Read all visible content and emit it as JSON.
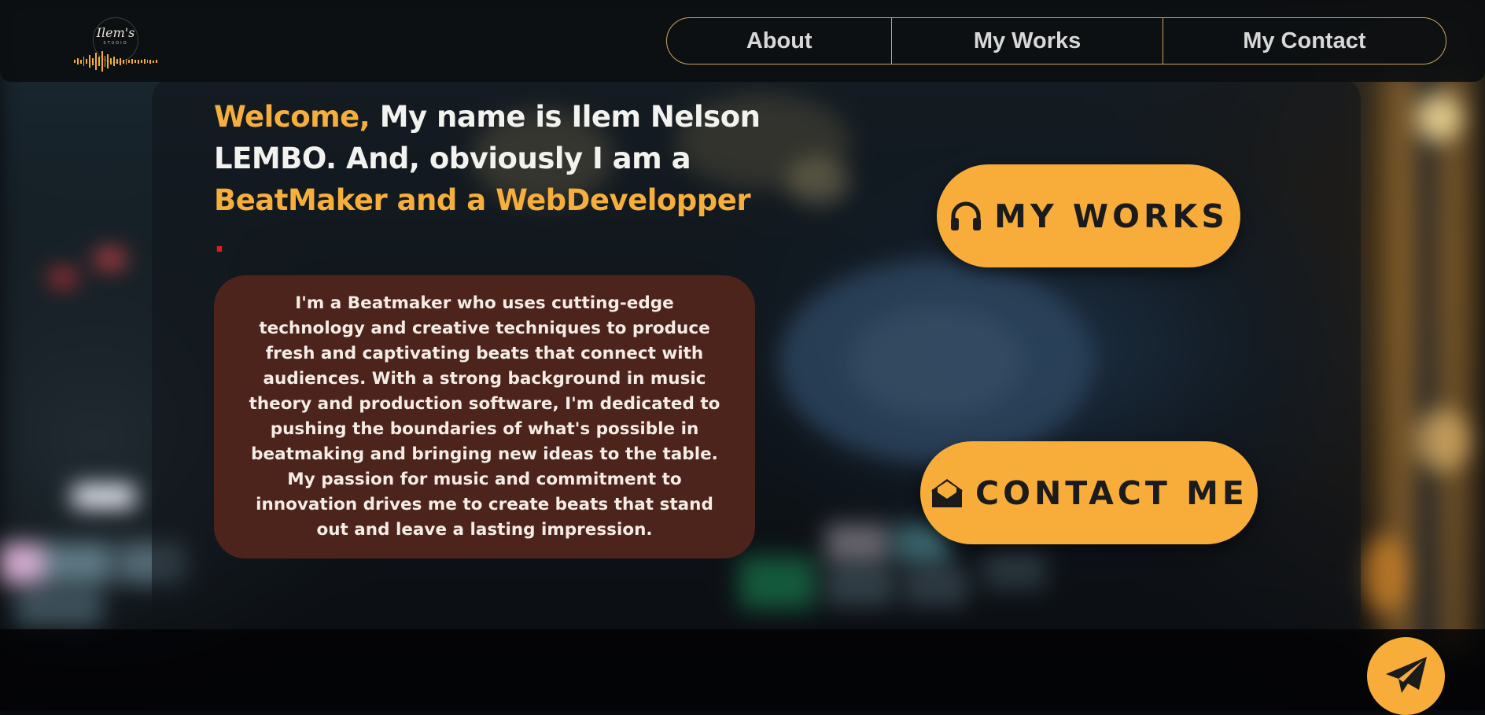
{
  "brand": {
    "logo_script": "Ilem's",
    "logo_sub": "STUDIO"
  },
  "nav": {
    "items": [
      "About",
      "My Works",
      "My Contact"
    ]
  },
  "headline": {
    "welcome": "Welcome,",
    "line_a": " My name is Ilem Nelson LEMBO. And, obviously I am a ",
    "roles": "BeatMaker and a WebDevelopper",
    "dot": " ."
  },
  "bio": "I'm a Beatmaker who uses cutting-edge technology and creative techniques to produce fresh and captivating beats that connect with audiences. With a strong background in music theory and production software, I'm dedicated to pushing the boundaries of what's possible in beatmaking and bringing new ideas to the table. My passion for music and commitment to innovation drives me to create beats that stand out and leave a lasting impression.",
  "buttons": {
    "works": {
      "label": "MY WORKS",
      "icon": "headphones-icon"
    },
    "contact": {
      "label": "CONTACT ME",
      "icon": "envelope-open-icon"
    },
    "fab": {
      "icon": "paper-plane-icon"
    }
  },
  "colors": {
    "accent": "#f8ad3b",
    "bio_card": "#4c241b",
    "headline_text": "#f2f2ee",
    "dot": "#e31b1b",
    "nav_border": "#c9a45e"
  }
}
